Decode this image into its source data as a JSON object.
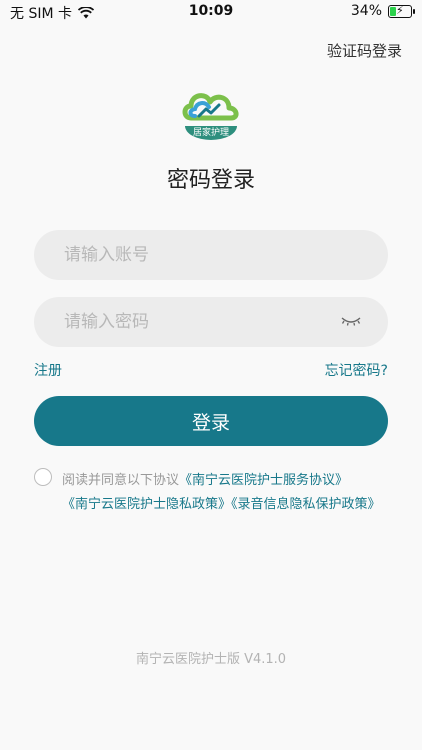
{
  "status_bar": {
    "carrier": "无 SIM 卡",
    "time": "10:09",
    "battery": "34%",
    "battery_level": 0.34
  },
  "header": {
    "alt_login_link": "验证码登录"
  },
  "logo": {
    "badge_text": "居家护理",
    "colors": {
      "teal": "#17788a",
      "green": "#7cc04b",
      "blue": "#3aa1d7"
    }
  },
  "login": {
    "title": "密码登录",
    "account_placeholder": "请输入账号",
    "password_placeholder": "请输入密码",
    "register_link": "注册",
    "forgot_link": "忘记密码?",
    "submit_label": "登录"
  },
  "agreement": {
    "prefix": "阅读并同意以下协议",
    "service_policy": "《南宁云医院护士服务协议》",
    "privacy_policy": "《南宁云医院护士隐私政策》",
    "recording_policy": "《录音信息隐私保护政策》"
  },
  "footer": {
    "version": "南宁云医院护士版 V4.1.0"
  },
  "theme": {
    "accent": "#17788a",
    "background": "#f9f9f9",
    "input_bg": "#ececec"
  }
}
